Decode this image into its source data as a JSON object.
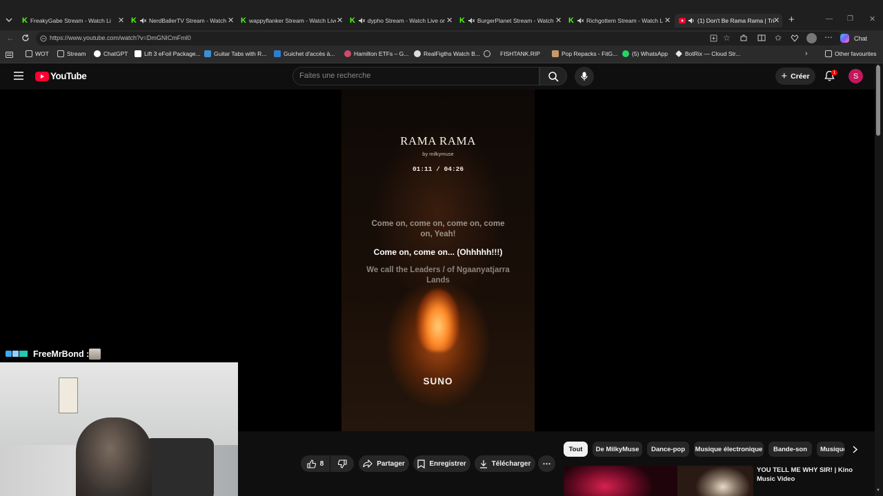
{
  "browser": {
    "tabs": [
      {
        "title": "FreakyGabe Stream - Watch Li",
        "icon": "kick-icon"
      },
      {
        "title": "NerdBallerTV Stream - Watch",
        "icon": "kick-icon"
      },
      {
        "title": "wappyflanker Stream - Watch Live",
        "icon": "kick-icon"
      },
      {
        "title": "dypho Stream - Watch Live on",
        "icon": "kick-icon"
      },
      {
        "title": "BurgerPlanet Stream - Watch",
        "icon": "kick-icon"
      },
      {
        "title": "Richgottem Stream - Watch L",
        "icon": "kick-icon"
      },
      {
        "title": "(1) Don't Be Rama Rama | Tri",
        "icon": "youtube-icon"
      }
    ],
    "url": "https://www.youtube.com/watch?v=DmGNICmFml0",
    "chat_label": "Chat",
    "bookmarks": [
      "WOT",
      "Stream",
      "ChatGPT",
      "Lift 3 eFoil Package...",
      "Guitar Tabs with R...",
      "Guichet d'accès à...",
      "Hamilton ETFs – G...",
      "RealFigths Watch B...",
      "FISHTANK.RIP",
      "Pop Repacks - FitG...",
      "(5) WhatsApp",
      "BotRix — Cloud Str..."
    ],
    "other_favourites": "Other favourites"
  },
  "youtube": {
    "logo_text": "YouTube",
    "search_placeholder": "Faites une recherche",
    "create_label": "Créer",
    "notification_count": "1",
    "avatar_letter": "S"
  },
  "video": {
    "song_title": "RAMA RAMA",
    "byline": "by milkymuse",
    "time": "01:11 / 04:26",
    "lyric_prev": "Come on, come on, come on, come on, Yeah!",
    "lyric_current": "Come on, come on... (Ohhhhh!!!)",
    "lyric_next": "We call the Leaders / of Ngaanyatjarra Lands",
    "watermark": "SUNO"
  },
  "webcam": {
    "name": "FreeMrBond :"
  },
  "actions": {
    "likes": "8",
    "share": "Partager",
    "save": "Enregistrer",
    "download": "Télécharger"
  },
  "chips": [
    "Tout",
    "De MilkyMuse",
    "Dance-pop",
    "Musique électronique",
    "Bande-son",
    "Musique"
  ],
  "recommendation": {
    "title": "YOU TELL ME WHY SIR! | Kino Music Video"
  }
}
